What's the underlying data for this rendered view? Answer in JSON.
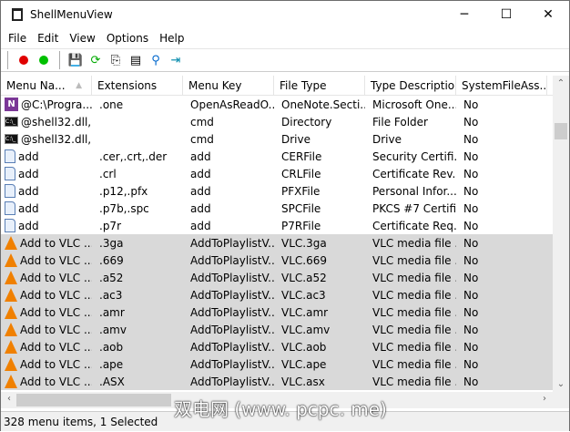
{
  "window": {
    "title": "ShellMenuView",
    "minimize": "─",
    "maximize": "☐",
    "close": "✕"
  },
  "menu": [
    "File",
    "Edit",
    "View",
    "Options",
    "Help"
  ],
  "toolbar": {
    "colors": {
      "red": "#e00000",
      "green": "#00c000"
    }
  },
  "columns": [
    "Menu Na...",
    "Extensions",
    "Menu Key",
    "File Type",
    "Type Description",
    "SystemFileAss..."
  ],
  "rows": [
    {
      "icon": "onenote-icon",
      "sel": false,
      "c": [
        "@C:\\Progra...",
        ".one",
        "OpenAsReadO...",
        "OneNote.Secti...",
        "Microsoft One...",
        "No"
      ]
    },
    {
      "icon": "cmd-icon",
      "sel": false,
      "c": [
        "@shell32.dll,...",
        "",
        "cmd",
        "Directory",
        "File Folder",
        "No"
      ]
    },
    {
      "icon": "cmd-icon",
      "sel": false,
      "c": [
        "@shell32.dll,...",
        "",
        "cmd",
        "Drive",
        "Drive",
        "No"
      ]
    },
    {
      "icon": "document-icon",
      "sel": false,
      "c": [
        "add",
        ".cer,.crt,.der",
        "add",
        "CERFile",
        "Security Certifi...",
        "No"
      ]
    },
    {
      "icon": "document-icon",
      "sel": false,
      "c": [
        "add",
        ".crl",
        "add",
        "CRLFile",
        "Certificate Rev...",
        "No"
      ]
    },
    {
      "icon": "document-icon",
      "sel": false,
      "c": [
        "add",
        ".p12,.pfx",
        "add",
        "PFXFile",
        "Personal Infor...",
        "No"
      ]
    },
    {
      "icon": "document-icon",
      "sel": false,
      "c": [
        "add",
        ".p7b,.spc",
        "add",
        "SPCFile",
        "PKCS #7 Certifi...",
        "No"
      ]
    },
    {
      "icon": "document-icon",
      "sel": false,
      "c": [
        "add",
        ".p7r",
        "add",
        "P7RFile",
        "Certificate Req...",
        "No"
      ]
    },
    {
      "icon": "vlc-icon",
      "sel": true,
      "c": [
        "Add to VLC ...",
        ".3ga",
        "AddToPlaylistV...",
        "VLC.3ga",
        "VLC media file ...",
        "No"
      ]
    },
    {
      "icon": "vlc-icon",
      "sel": true,
      "c": [
        "Add to VLC ...",
        ".669",
        "AddToPlaylistV...",
        "VLC.669",
        "VLC media file ...",
        "No"
      ]
    },
    {
      "icon": "vlc-icon",
      "sel": true,
      "c": [
        "Add to VLC ...",
        ".a52",
        "AddToPlaylistV...",
        "VLC.a52",
        "VLC media file ...",
        "No"
      ]
    },
    {
      "icon": "vlc-icon",
      "sel": true,
      "c": [
        "Add to VLC ...",
        ".ac3",
        "AddToPlaylistV...",
        "VLC.ac3",
        "VLC media file ...",
        "No"
      ]
    },
    {
      "icon": "vlc-icon",
      "sel": true,
      "c": [
        "Add to VLC ...",
        ".amr",
        "AddToPlaylistV...",
        "VLC.amr",
        "VLC media file ...",
        "No"
      ]
    },
    {
      "icon": "vlc-icon",
      "sel": true,
      "c": [
        "Add to VLC ...",
        ".amv",
        "AddToPlaylistV...",
        "VLC.amv",
        "VLC media file ...",
        "No"
      ]
    },
    {
      "icon": "vlc-icon",
      "sel": true,
      "c": [
        "Add to VLC ...",
        ".aob",
        "AddToPlaylistV...",
        "VLC.aob",
        "VLC media file ...",
        "No"
      ]
    },
    {
      "icon": "vlc-icon",
      "sel": true,
      "c": [
        "Add to VLC ...",
        ".ape",
        "AddToPlaylistV...",
        "VLC.ape",
        "VLC media file ...",
        "No"
      ]
    },
    {
      "icon": "vlc-icon",
      "sel": true,
      "c": [
        "Add to VLC ...",
        ".ASX",
        "AddToPlaylistV...",
        "VLC.asx",
        "VLC media file ...",
        "No"
      ]
    }
  ],
  "status": "328 menu items, 1 Selected",
  "watermark": "双电网 (www. pcpc. me)"
}
